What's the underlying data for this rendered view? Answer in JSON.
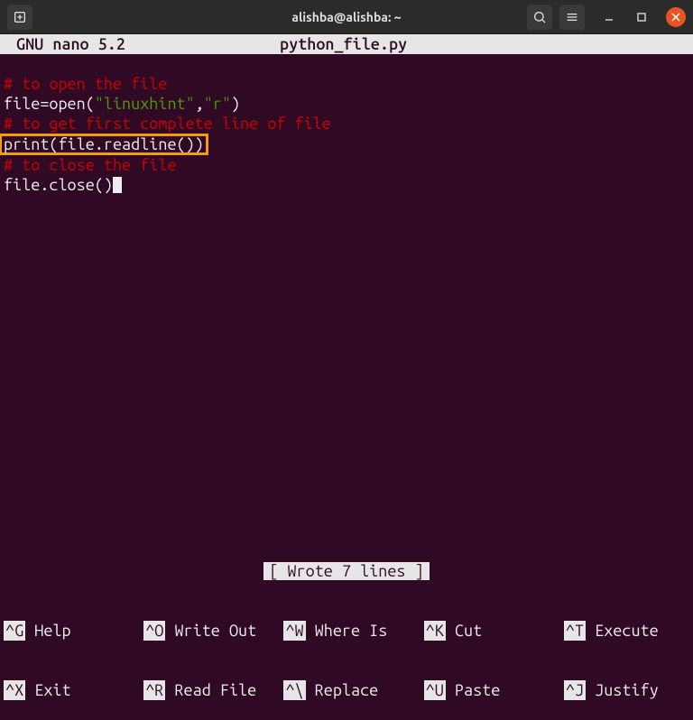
{
  "window": {
    "title": "alishba@alishba: ~"
  },
  "nano": {
    "version": "GNU nano 5.2",
    "filename": "python_file.py",
    "status": "[ Wrote 7 lines ]"
  },
  "code": {
    "line1_comment": "# to open the file",
    "line2_pre": "file=open(",
    "line2_str1": "\"linuxhint\"",
    "line2_mid": ",",
    "line2_str2": "\"r\"",
    "line2_post": ")",
    "line3_comment": "# to get first complete line of file",
    "line4_highlighted": "print(file.readline())",
    "line5_comment": "# to close the file",
    "line6": "file.close()"
  },
  "shortcuts": {
    "row1": [
      {
        "key": "^G",
        "label": "Help"
      },
      {
        "key": "^O",
        "label": "Write Out"
      },
      {
        "key": "^W",
        "label": "Where Is"
      },
      {
        "key": "^K",
        "label": "Cut"
      },
      {
        "key": "^T",
        "label": "Execute"
      }
    ],
    "row2": [
      {
        "key": "^X",
        "label": "Exit"
      },
      {
        "key": "^R",
        "label": "Read File"
      },
      {
        "key": "^\\",
        "label": "Replace"
      },
      {
        "key": "^U",
        "label": "Paste"
      },
      {
        "key": "^J",
        "label": "Justify"
      }
    ]
  }
}
